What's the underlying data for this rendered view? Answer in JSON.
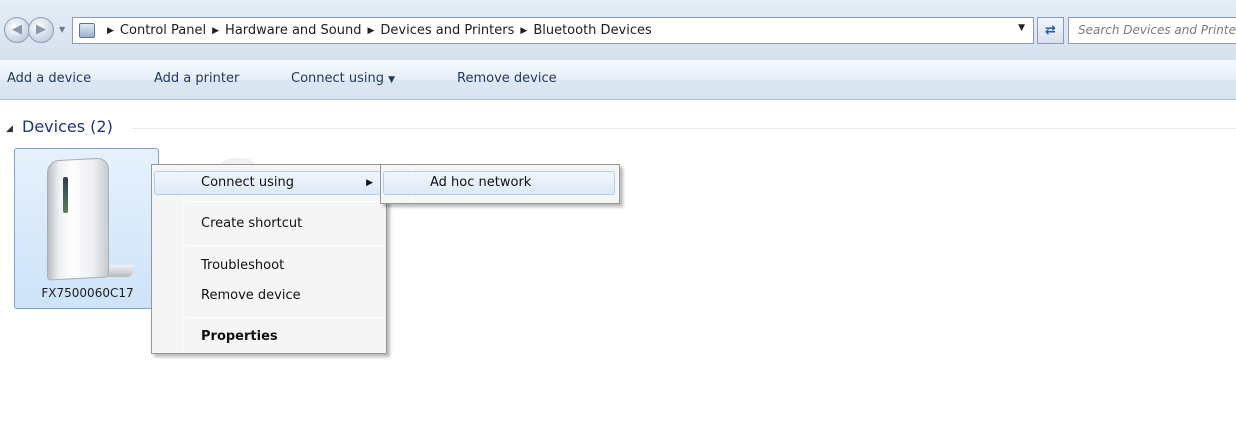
{
  "address_bar": {
    "back_icon": "back-arrow-icon",
    "forward_icon": "forward-arrow-icon",
    "breadcrumbs": [
      "Control Panel",
      "Hardware and Sound",
      "Devices and Printers",
      "Bluetooth Devices"
    ],
    "search_placeholder": "Search Devices and Printers"
  },
  "command_bar": {
    "add_device": "Add a device",
    "add_printer": "Add a printer",
    "connect_using": "Connect using",
    "remove_device": "Remove device"
  },
  "group": {
    "title": "Devices (2)"
  },
  "devices": [
    {
      "label": "FX7500060C17",
      "icon": "rfid-reader-device-icon"
    }
  ],
  "context_menu": {
    "items": [
      {
        "label": "Connect using",
        "has_submenu": true,
        "highlighted": true
      },
      {
        "label": "Create shortcut"
      },
      {
        "label": "Troubleshoot"
      },
      {
        "label": "Remove device"
      },
      {
        "label": "Properties",
        "bold": true
      }
    ],
    "submenu": {
      "items": [
        {
          "label": "Ad hoc network",
          "highlighted": true
        }
      ]
    }
  },
  "colors": {
    "header_text": "#1e3287",
    "selection_fill": "#cde3f9",
    "selection_border": "#7da2ce"
  }
}
